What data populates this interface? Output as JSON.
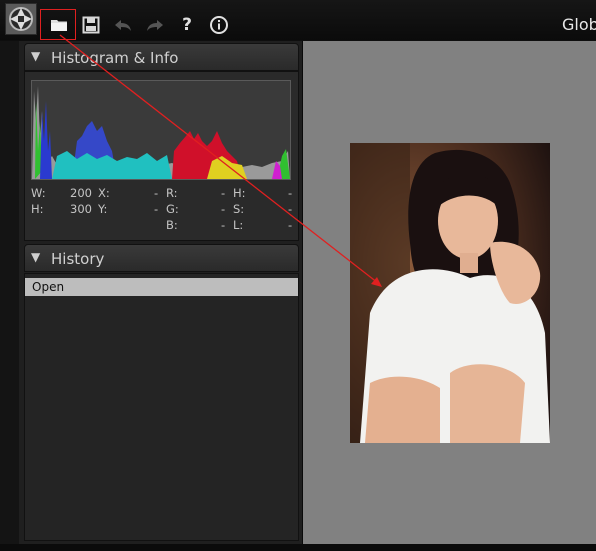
{
  "window": {
    "title": "Glob"
  },
  "toolbar": {
    "buttons": [
      {
        "name": "open-folder",
        "icon": "folder-icon"
      },
      {
        "name": "save",
        "icon": "floppy-disk-icon"
      },
      {
        "name": "undo",
        "icon": "undo-arrow-icon"
      },
      {
        "name": "redo",
        "icon": "redo-arrow-icon"
      },
      {
        "name": "help",
        "icon": "question-mark-icon",
        "glyph": "?"
      },
      {
        "name": "info",
        "icon": "info-circle-icon"
      }
    ]
  },
  "histogram_panel": {
    "title": "Histogram & Info",
    "info": {
      "w_label": "W:",
      "w_value": "200",
      "h_label": "H:",
      "h_value": "300",
      "x_label": "X:",
      "x_value": "-",
      "y_label": "Y:",
      "y_value": "-",
      "r_label": "R:",
      "r_value": "-",
      "g_label": "G:",
      "g_value": "-",
      "b_label": "B:",
      "b_value": "-",
      "hh_label": "H:",
      "hh_value": "-",
      "s_label": "S:",
      "s_value": "-",
      "l_label": "L:",
      "l_value": "-"
    }
  },
  "history_panel": {
    "title": "History",
    "items": [
      "Open"
    ]
  },
  "colors": {
    "annotation": "#e02020",
    "canvas": "#818181",
    "panel": "#1f1f1f"
  }
}
